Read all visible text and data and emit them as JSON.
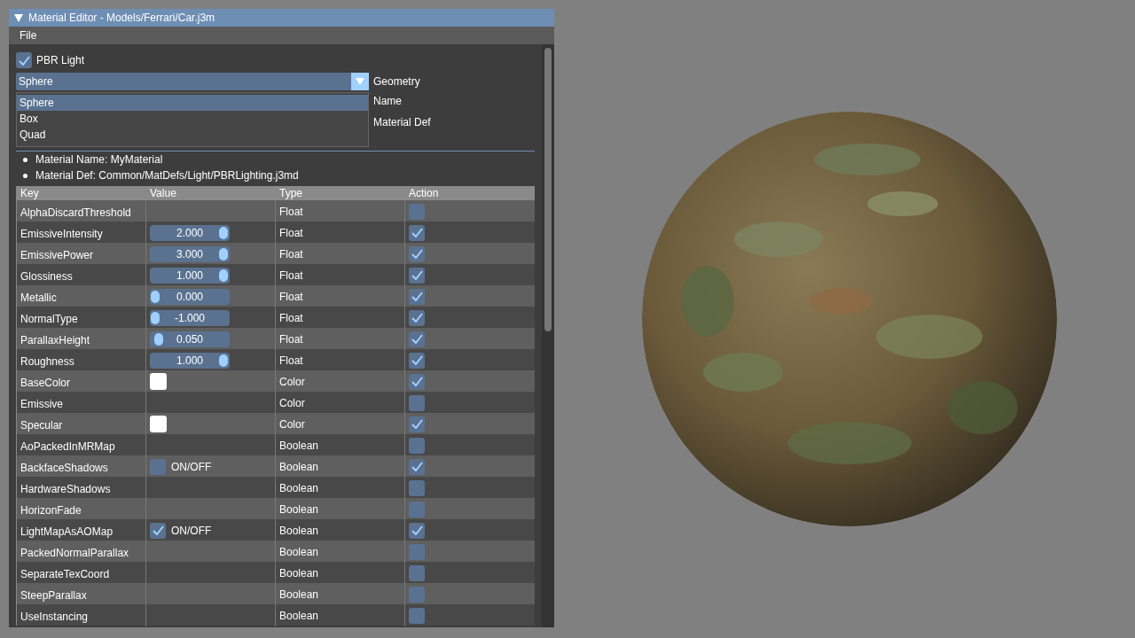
{
  "window": {
    "title": "Material Editor - Models/Ferrari/Car.j3m"
  },
  "menu": [
    "File"
  ],
  "pbr_light": {
    "label": "PBR Light",
    "checked": true
  },
  "geometry": {
    "label": "Geometry",
    "value": "Sphere",
    "expanded": true,
    "options": [
      {
        "label": "Sphere",
        "selected": true
      },
      {
        "label": "Box",
        "selected": false
      },
      {
        "label": "Quad",
        "selected": false
      }
    ]
  },
  "fields": [
    "Name",
    "Material Def"
  ],
  "info": [
    "Material Name: MyMaterial",
    "Material Def: Common/MatDefs/Light/PBRLighting.j3md"
  ],
  "table": {
    "columns": [
      "Key",
      "Value",
      "Type",
      "Action"
    ],
    "rows": [
      {
        "key": "AlphaDiscardThreshold",
        "value": {
          "kind": "none"
        },
        "type": "Float",
        "checked": false
      },
      {
        "key": "EmissiveIntensity",
        "value": {
          "kind": "slider",
          "text": "2.000",
          "level": 1
        },
        "type": "Float",
        "checked": true
      },
      {
        "key": "EmissivePower",
        "value": {
          "kind": "slider",
          "text": "3.000",
          "level": 1
        },
        "type": "Float",
        "checked": true
      },
      {
        "key": "Glossiness",
        "value": {
          "kind": "slider",
          "text": "1.000",
          "level": 1
        },
        "type": "Float",
        "checked": true
      },
      {
        "key": "Metallic",
        "value": {
          "kind": "slider",
          "text": "0.000",
          "level": 0
        },
        "type": "Float",
        "checked": true
      },
      {
        "key": "NormalType",
        "value": {
          "kind": "slider",
          "text": "-1.000",
          "level": 0
        },
        "type": "Float",
        "checked": true
      },
      {
        "key": "ParallaxHeight",
        "value": {
          "kind": "slider",
          "text": "0.050",
          "level": 0.05
        },
        "type": "Float",
        "checked": true
      },
      {
        "key": "Roughness",
        "value": {
          "kind": "slider",
          "text": "1.000",
          "level": 1
        },
        "type": "Float",
        "checked": true
      },
      {
        "key": "BaseColor",
        "value": {
          "kind": "color",
          "color": "#ffffff"
        },
        "type": "Color",
        "checked": true
      },
      {
        "key": "Emissive",
        "value": {
          "kind": "none"
        },
        "type": "Color",
        "checked": false
      },
      {
        "key": "Specular",
        "value": {
          "kind": "color",
          "color": "#ffffff"
        },
        "type": "Color",
        "checked": true
      },
      {
        "key": "AoPackedInMRMap",
        "value": {
          "kind": "none"
        },
        "type": "Boolean",
        "checked": false
      },
      {
        "key": "BackfaceShadows",
        "value": {
          "kind": "toggle",
          "text": "ON/OFF",
          "checked": false
        },
        "type": "Boolean",
        "checked": true
      },
      {
        "key": "HardwareShadows",
        "value": {
          "kind": "none"
        },
        "type": "Boolean",
        "checked": false
      },
      {
        "key": "HorizonFade",
        "value": {
          "kind": "none"
        },
        "type": "Boolean",
        "checked": false
      },
      {
        "key": "LightMapAsAOMap",
        "value": {
          "kind": "toggle",
          "text": "ON/OFF",
          "checked": true
        },
        "type": "Boolean",
        "checked": true
      },
      {
        "key": "PackedNormalParallax",
        "value": {
          "kind": "none"
        },
        "type": "Boolean",
        "checked": false
      },
      {
        "key": "SeparateTexCoord",
        "value": {
          "kind": "none"
        },
        "type": "Boolean",
        "checked": false
      },
      {
        "key": "SteepParallax",
        "value": {
          "kind": "none"
        },
        "type": "Boolean",
        "checked": false
      },
      {
        "key": "UseInstancing",
        "value": {
          "kind": "none"
        },
        "type": "Boolean",
        "checked": false
      }
    ]
  },
  "preview": {
    "kind": "picture"
  }
}
